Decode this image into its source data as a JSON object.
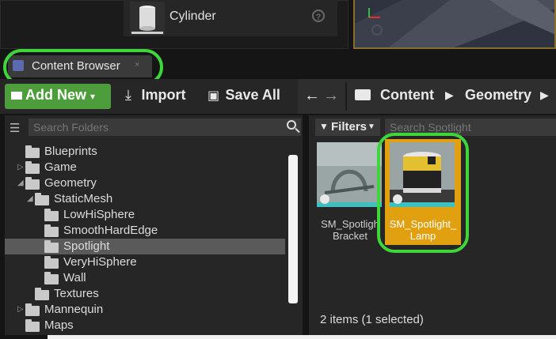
{
  "details": {
    "asset_name": "Cylinder",
    "help_glyph": "?"
  },
  "tab": {
    "label": "Content Browser",
    "close_glyph": "×"
  },
  "toolbar": {
    "add_new_label": "Add New",
    "import_label": "Import",
    "save_all_label": "Save All"
  },
  "breadcrumb": {
    "items": [
      "Content",
      "Geometry"
    ]
  },
  "folders": {
    "search_placeholder": "Search Folders",
    "tree": [
      {
        "label": "Blueprints",
        "depth": 1,
        "expander": ""
      },
      {
        "label": "Game",
        "depth": 1,
        "expander": "▷"
      },
      {
        "label": "Geometry",
        "depth": 1,
        "expander": "◢"
      },
      {
        "label": "StaticMesh",
        "depth": 2,
        "expander": "◢"
      },
      {
        "label": "LowHiSphere",
        "depth": 3,
        "expander": ""
      },
      {
        "label": "SmoothHardEdge",
        "depth": 3,
        "expander": ""
      },
      {
        "label": "Spotlight",
        "depth": 3,
        "expander": "",
        "selected": true
      },
      {
        "label": "VeryHiSphere",
        "depth": 3,
        "expander": ""
      },
      {
        "label": "Wall",
        "depth": 3,
        "expander": ""
      },
      {
        "label": "Textures",
        "depth": 2,
        "expander": ""
      },
      {
        "label": "Mannequin",
        "depth": 1,
        "expander": "▷"
      },
      {
        "label": "Maps",
        "depth": 1,
        "expander": ""
      }
    ]
  },
  "assets": {
    "filters_label": "Filters",
    "search_placeholder": "Search Spotlight",
    "items": [
      {
        "name_line1": "SM_Spotligh",
        "name_line2": "Bracket",
        "selected": false
      },
      {
        "name_line1": "SM_Spotlight_",
        "name_line2": "Lamp",
        "selected": true
      }
    ],
    "status": "2 items (1 selected)"
  },
  "colors": {
    "highlight_ring": "#3ed63a",
    "selected_tile": "#e0a010",
    "add_new_green": "#4e9d3d"
  }
}
